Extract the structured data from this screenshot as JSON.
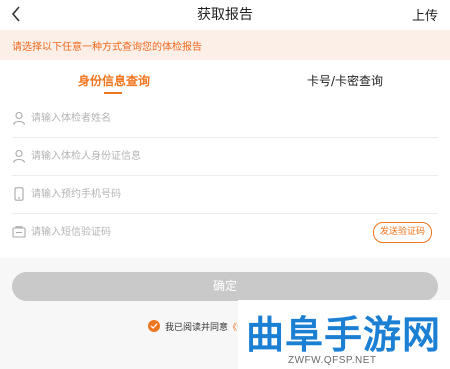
{
  "header": {
    "title": "获取报告",
    "upload_label": "上传"
  },
  "notice": {
    "text": "请选择以下任意一种方式查询您的体检报告"
  },
  "tabs": [
    {
      "label": "身份信息查询",
      "active": true
    },
    {
      "label": "卡号/卡密查询",
      "active": false
    }
  ],
  "form": {
    "name_placeholder": "请输入体检者姓名",
    "id_placeholder": "请输入体检人身份证信息",
    "phone_placeholder": "请输入预约手机号码",
    "sms_placeholder": "请输入短信验证码",
    "send_code_label": "发送验证码"
  },
  "confirm_label": "确定",
  "agreement": {
    "text": "我已阅读并同意",
    "link": "《优"
  },
  "watermark": {
    "title": "曲阜手游网",
    "subtitle": "ZWFW.QFSP.NET"
  },
  "colors": {
    "accent": "#f0751f",
    "notice_bg": "#fcefe7",
    "button_disabled": "#c9c9c9",
    "watermark_blue": "#1b7fd4"
  }
}
